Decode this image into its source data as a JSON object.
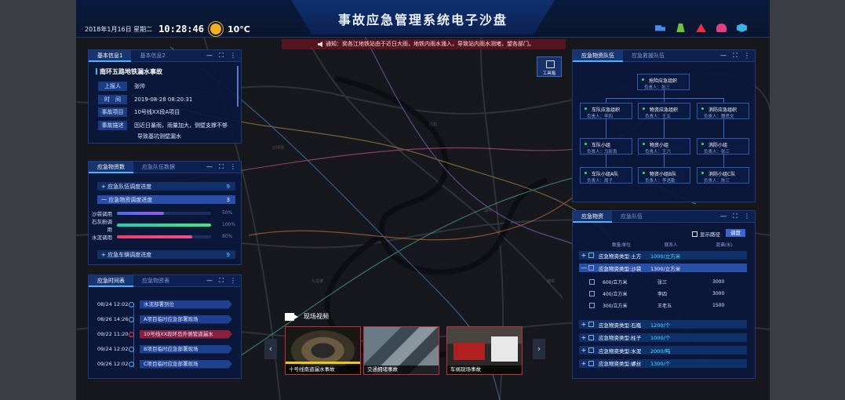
{
  "header": {
    "title": "事故应急管理系统电子沙盘",
    "date": "2018年1月16日 星期二",
    "time": "10:28:46",
    "temperature": "10°C",
    "weather_icon": "sun-icon",
    "icons": [
      {
        "name": "truck-icon",
        "color": "#4a8ae8"
      },
      {
        "name": "worker-icon",
        "color": "#70c040"
      },
      {
        "name": "warning-icon",
        "color": "#e83040"
      },
      {
        "name": "people-icon",
        "color": "#e04080"
      },
      {
        "name": "cube-icon",
        "color": "#3ab0e8"
      }
    ]
  },
  "notice": "通知：奕各江地铁站由于近日大雨，地铁内雨水涌入，导致站内雨水测堵，望各部门。",
  "toolbox_label": "工具箱",
  "basic_info": {
    "tabs": [
      "基本信息1",
      "基本信息2"
    ],
    "title": "南环五路地铁漏水事故",
    "rows": [
      {
        "key": "上报人",
        "value": "张帅"
      },
      {
        "key": "时　间",
        "value": "2019-08-28  08:20:31"
      },
      {
        "key": "事故项目",
        "value": "10号线XX段A项目"
      },
      {
        "key": "事故描述",
        "value": "因近日暴雨，雨量加大，侧壁支撑不够",
        "value2": "导致基坑侧壁漏水"
      }
    ]
  },
  "progress_panel": {
    "tabs": [
      "应急物资数",
      "应急队伍数据"
    ],
    "rows": [
      {
        "label": "+ 应急队伍调度进度",
        "value": "9"
      },
      {
        "label": "一 应急物资调度进度",
        "value": "3"
      }
    ],
    "bars": [
      {
        "label": "沙袋调用",
        "percent": 50,
        "pct_label": "50%",
        "color": "linear-gradient(90deg,#4a6de8,#9a5ae8)"
      },
      {
        "label": "石灰粉调用",
        "percent": 100,
        "pct_label": "100%",
        "color": "linear-gradient(90deg,#1fd0b0,#40e880)"
      },
      {
        "label": "水泥调用",
        "percent": 80,
        "pct_label": "80%",
        "color": "linear-gradient(90deg,#e8406a,#f0508a)"
      }
    ],
    "last_row": {
      "label": "+ 应急车辆调度进度",
      "value": "9"
    }
  },
  "timeline": {
    "tabs": [
      "应急时间表",
      "应急物资表"
    ],
    "events": [
      {
        "date": "08/24  12:02",
        "text": "水泥部署到位",
        "dot": "#4db3ff",
        "bg": "#1f4090"
      },
      {
        "date": "08/26  14:26",
        "text": "A项目临时应急部署现场",
        "dot": "#4db3ff",
        "bg": "#1f4090"
      },
      {
        "date": "09/22  11:20",
        "text": "10号线XX段环岛外侧管道漏水",
        "dot": "#e8405a",
        "bg": "#8a2040"
      },
      {
        "date": "09/24  12:02",
        "text": "B项目临时应急部署现场",
        "dot": "#4db3ff",
        "bg": "#1f4090"
      },
      {
        "date": "09/26  12:02",
        "text": "C项目临时应急部署现场",
        "dot": "#4db3ff",
        "bg": "#1f4090"
      }
    ]
  },
  "video": {
    "title": "现场视频",
    "items": [
      {
        "caption": "十号线南道漏水事故"
      },
      {
        "caption": "交通拥堵事故"
      },
      {
        "caption": "车祸现场事故"
      }
    ]
  },
  "org_panel": {
    "tabs": [
      "应急物资队伍",
      "应急救援队伍"
    ],
    "nodes": [
      {
        "name": "抢险应急组织",
        "leader": "负责人：张三"
      },
      {
        "name": "车队应急组织",
        "leader": "负责人：李四"
      },
      {
        "name": "物资应急组织",
        "leader": "负责人：王五"
      },
      {
        "name": "消防应急组织",
        "leader": "负责人：魏思文"
      },
      {
        "name": "车队小组",
        "leader": "负责人：马彩良"
      },
      {
        "name": "物资小组",
        "leader": "负责人：王六"
      },
      {
        "name": "消防小组",
        "leader": "负责人：张三"
      },
      {
        "name": "车队小组A队",
        "leader": "负责人：周子"
      },
      {
        "name": "物资小组B队",
        "leader": "负责人：李语勤"
      },
      {
        "name": "消防小组C队",
        "leader": "负责人：陈三"
      }
    ]
  },
  "supplies_panel": {
    "tabs": [
      "应急物资",
      "应急队伍"
    ],
    "show_route": "显示路径",
    "dispatch": "调度",
    "headers": [
      "数量/单位",
      "联系人",
      "距离(米)"
    ],
    "rows": [
      {
        "name": "应急物资类型:土方",
        "qty": "1000/立方米"
      },
      {
        "name": "应急物资类型:沙袋",
        "qty": "1300/立方米"
      }
    ],
    "subrows": [
      {
        "a": "600/立方米",
        "b": "张三",
        "c": "3000"
      },
      {
        "a": "400/立方米",
        "b": "李四",
        "c": "3000"
      },
      {
        "a": "300/立方米",
        "b": "王老五",
        "c": "1500"
      }
    ],
    "rows2": [
      {
        "name": "应急物资类型:石瓶",
        "qty": "1200/个"
      },
      {
        "name": "应急物资类型:柱子",
        "qty": "1000/个"
      },
      {
        "name": "应急物资类型:水泥",
        "qty": "2000/吨"
      },
      {
        "name": "应急物资类型:螺丝",
        "qty": "1300/个"
      }
    ]
  }
}
